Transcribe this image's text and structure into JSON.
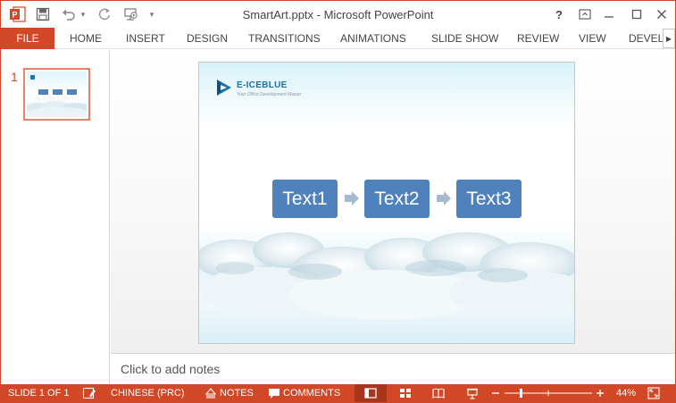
{
  "window": {
    "title": "SmartArt.pptx - Microsoft PowerPoint",
    "help_label": "?",
    "qat": {
      "app_icon_letter": "P",
      "customize_glyph": "▾"
    }
  },
  "ribbon": {
    "file_label": "FILE",
    "tabs": [
      {
        "label": "HOME"
      },
      {
        "label": "INSERT"
      },
      {
        "label": "DESIGN"
      },
      {
        "label": "TRANSITIONS"
      },
      {
        "label": "ANIMATIONS"
      },
      {
        "label": "SLIDE SHOW"
      },
      {
        "label": "REVIEW"
      },
      {
        "label": "VIEW"
      },
      {
        "label": "DEVELO"
      }
    ]
  },
  "thumbnails": [
    {
      "number": "1",
      "selected": true
    }
  ],
  "slide": {
    "logo_name": "E-ICEBLUE",
    "logo_tagline": "Your Office Development Master",
    "smartart_items": [
      "Text1",
      "Text2",
      "Text3"
    ],
    "box_color": "#4F81BD",
    "arrow_color": "#A7B9D1"
  },
  "notes": {
    "placeholder": "Click to add notes"
  },
  "statusbar": {
    "slide_indicator": "SLIDE 1 OF 1",
    "language": "CHINESE (PRC)",
    "notes_label": "NOTES",
    "comments_label": "COMMENTS",
    "zoom": "44%",
    "zoom_level_fraction": 0.44
  },
  "theme": {
    "accent": "#D24726"
  }
}
